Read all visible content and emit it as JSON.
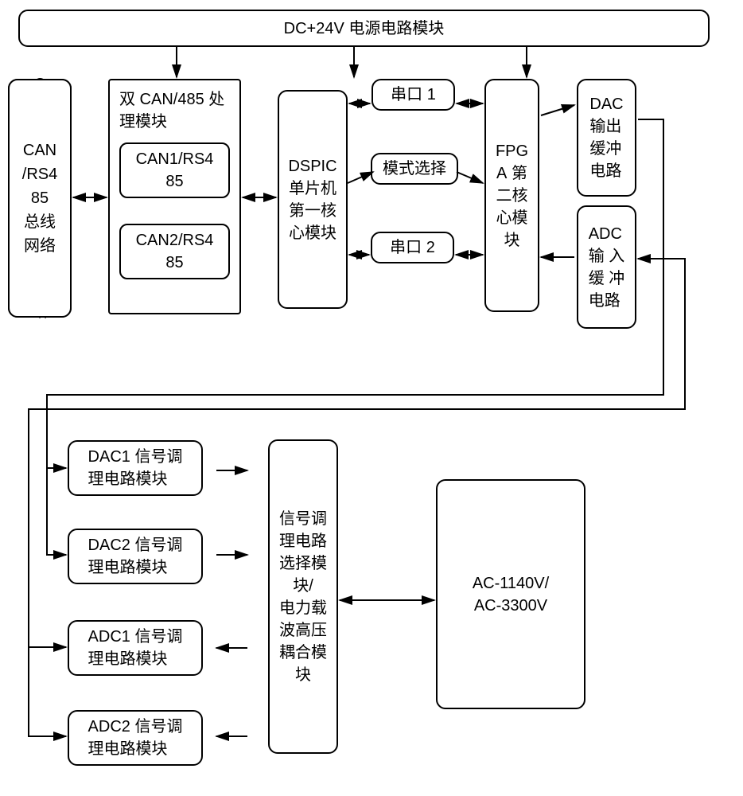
{
  "top": {
    "power": "DC+24V 电源电路模块",
    "can_bus": "CAN/RS485总线网络",
    "dual_can_label": "双 CAN/485 处理模块",
    "can1": "CAN1/RS485",
    "can2": "CAN2/RS485",
    "dspic": "DSPIC单片机第一核心模块",
    "uart1": "串口 1",
    "mode": "模式选择",
    "uart2": "串口 2",
    "fpga": "FPGA 第二核心模块",
    "dac_buf": "DAC 输出缓冲电路",
    "adc_buf": "ADC 输 入缓 冲电路"
  },
  "bottom": {
    "dac1": "DAC1 信号调理电路模块",
    "dac2": "DAC2 信号调理电路模块",
    "adc1": "ADC1 信号调理电路模块",
    "adc2": "ADC2 信号调理电路模块",
    "selector": "信号调理电路选择模块/电力载波高压耦合模块",
    "ac": "AC-1140V/AC-3300V"
  }
}
